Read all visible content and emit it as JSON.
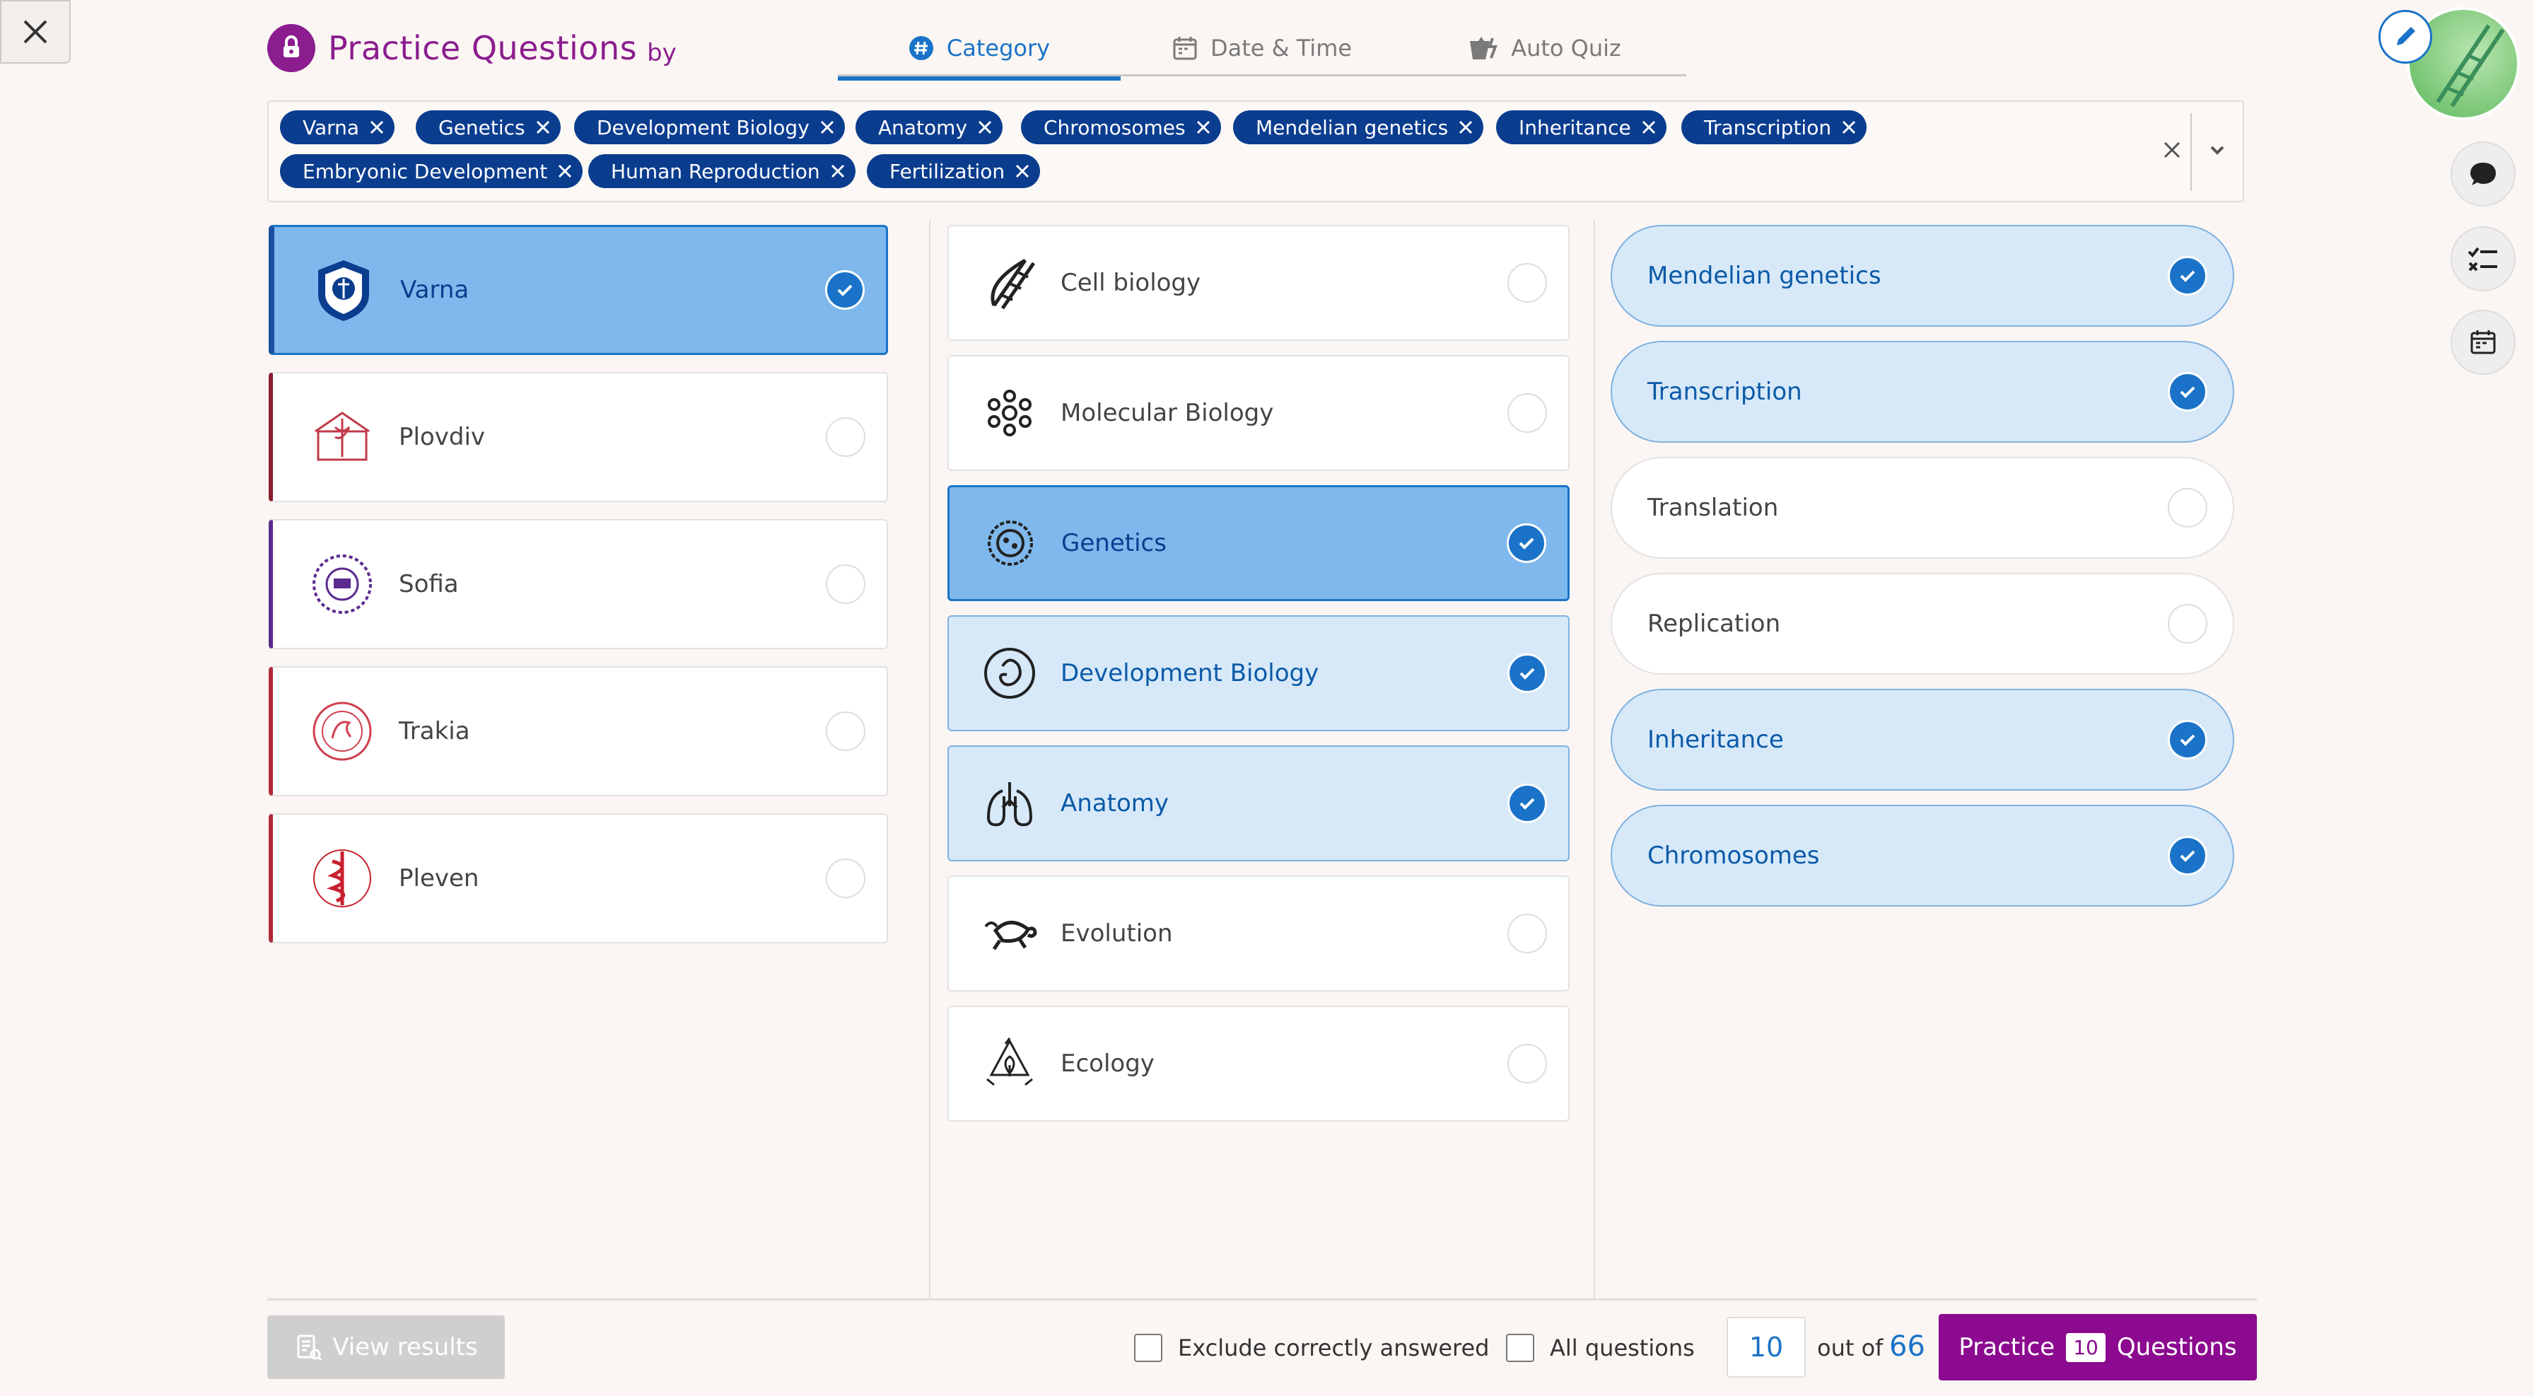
{
  "header": {
    "title": "Practice Questions",
    "by": "by",
    "tabs": [
      {
        "label": "Category",
        "icon": "hash-icon",
        "active": true
      },
      {
        "label": "Date & Time",
        "icon": "calendar-icon",
        "active": false
      },
      {
        "label": "Auto Quiz",
        "icon": "auto-quiz-icon",
        "active": false
      }
    ]
  },
  "chips": [
    "Varna",
    "Genetics",
    "Development Biology",
    "Anatomy",
    "Chromosomes",
    "Mendelian genetics",
    "Inheritance",
    "Transcription",
    "Embryonic Development",
    "Human Reproduction",
    "Fertilization"
  ],
  "universities": [
    {
      "label": "Varna",
      "selected": true
    },
    {
      "label": "Plovdiv",
      "selected": false
    },
    {
      "label": "Sofia",
      "selected": false
    },
    {
      "label": "Trakia",
      "selected": false
    },
    {
      "label": "Pleven",
      "selected": false
    }
  ],
  "subjects": [
    {
      "label": "Cell biology",
      "icon": "dna-icon",
      "selected": false
    },
    {
      "label": "Molecular Biology",
      "icon": "molecule-icon",
      "selected": false
    },
    {
      "label": "Genetics",
      "icon": "cell-icon",
      "selected": true
    },
    {
      "label": "Development Biology",
      "icon": "embryo-icon",
      "selected": true
    },
    {
      "label": "Anatomy",
      "icon": "lungs-icon",
      "selected": true
    },
    {
      "label": "Evolution",
      "icon": "turtle-icon",
      "selected": false
    },
    {
      "label": "Ecology",
      "icon": "recycle-icon",
      "selected": false
    }
  ],
  "topics": [
    {
      "label": "Mendelian genetics",
      "selected": true
    },
    {
      "label": "Transcription",
      "selected": true
    },
    {
      "label": "Translation",
      "selected": false
    },
    {
      "label": "Replication",
      "selected": false
    },
    {
      "label": "Inheritance",
      "selected": true
    },
    {
      "label": "Chromosomes",
      "selected": true
    }
  ],
  "footer": {
    "view_results": "View results",
    "exclude_label": "Exclude correctly answered",
    "all_questions_label": "All questions",
    "count": "10",
    "out_of": "out of",
    "total": "66",
    "practice_label": "Practice",
    "practice_count": "10",
    "questions_label": "Questions"
  },
  "colors": {
    "brand": "#8b1d8f",
    "accent": "#1a73c8",
    "chip": "#0b3d8f",
    "selected_strong": "#7fb8ec",
    "selected_light": "#d7e9f9"
  }
}
